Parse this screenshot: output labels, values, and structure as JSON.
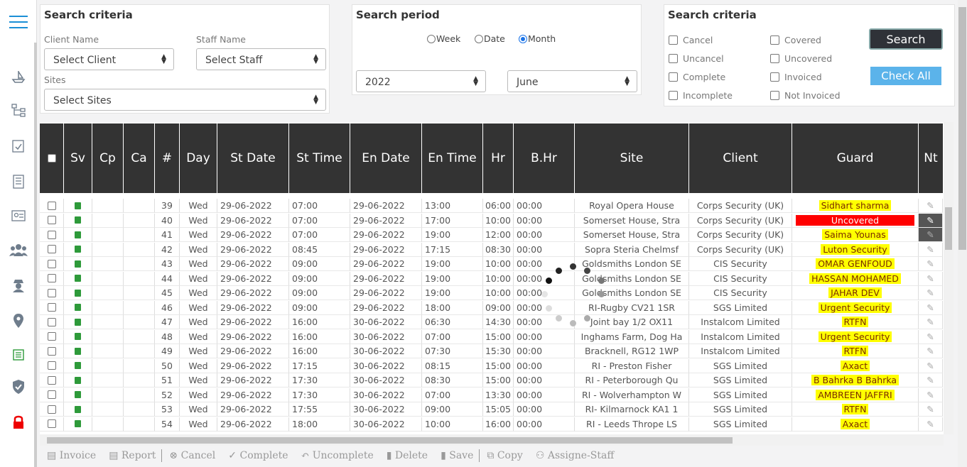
{
  "left_panel": {
    "title": "Search criteria",
    "client_label": "Client Name",
    "client_value": "Select Client",
    "staff_label": "Staff Name",
    "staff_value": "Select Staff",
    "sites_label": "Sites",
    "sites_value": "Select Sites"
  },
  "period_panel": {
    "title": "Search period",
    "week": "Week",
    "date": "Date",
    "month": "Month",
    "selected": "Month",
    "year": "2022",
    "month_value": "June"
  },
  "right_panel": {
    "title": "Search criteria",
    "checks": [
      "Cancel",
      "Uncancel",
      "Complete",
      "Incomplete",
      "Covered",
      "Uncovered",
      "Invoiced",
      "Not Invoiced"
    ],
    "search_btn": "Search",
    "check_all_btn": "Check All"
  },
  "table": {
    "headers": [
      "",
      "Sv",
      "Cp",
      "Ca",
      "#",
      "Day",
      "St Date",
      "St Time",
      "En Date",
      "En Time",
      "Hr",
      "B.Hr",
      "Site",
      "Client",
      "Guard",
      "Nt"
    ],
    "rows": [
      {
        "n": "39",
        "day": "Wed",
        "sd": "29-06-2022",
        "st": "07:00",
        "ed": "29-06-2022",
        "et": "13:00",
        "hr": "06:00",
        "bhr": "00:00",
        "site": "Royal Opera House",
        "client": "Corps Security (UK)",
        "guard": "Sidhart sharma",
        "gtype": "hl"
      },
      {
        "n": "40",
        "day": "Wed",
        "sd": "29-06-2022",
        "st": "07:00",
        "ed": "29-06-2022",
        "et": "17:00",
        "hr": "10:00",
        "bhr": "00:00",
        "site": "Somerset House, Stra",
        "client": "Corps Security (UK)",
        "guard": "Uncovered",
        "gtype": "red"
      },
      {
        "n": "41",
        "day": "Wed",
        "sd": "29-06-2022",
        "st": "07:00",
        "ed": "29-06-2022",
        "et": "19:00",
        "hr": "12:00",
        "bhr": "00:00",
        "site": "Somerset House, Stra",
        "client": "Corps Security (UK)",
        "guard": "Saima Younas",
        "gtype": "hl"
      },
      {
        "n": "42",
        "day": "Wed",
        "sd": "29-06-2022",
        "st": "08:45",
        "ed": "29-06-2022",
        "et": "17:15",
        "hr": "08:30",
        "bhr": "00:00",
        "site": "Sopra Steria Chelmsf",
        "client": "Corps Security (UK)",
        "guard": "Luton Security",
        "gtype": "hl"
      },
      {
        "n": "43",
        "day": "Wed",
        "sd": "29-06-2022",
        "st": "09:00",
        "ed": "29-06-2022",
        "et": "19:00",
        "hr": "10:00",
        "bhr": "00:00",
        "site": "Goldsmiths London SE",
        "client": "CIS Security",
        "guard": "OMAR GENFOUD",
        "gtype": "hl"
      },
      {
        "n": "44",
        "day": "Wed",
        "sd": "29-06-2022",
        "st": "09:00",
        "ed": "29-06-2022",
        "et": "19:00",
        "hr": "10:00",
        "bhr": "00:00",
        "site": "Goldsmiths London SE",
        "client": "CIS Security",
        "guard": "HASSAN MOHAMED",
        "gtype": "hl"
      },
      {
        "n": "45",
        "day": "Wed",
        "sd": "29-06-2022",
        "st": "09:00",
        "ed": "29-06-2022",
        "et": "19:00",
        "hr": "10:00",
        "bhr": "00:00",
        "site": "Goldsmiths London SE",
        "client": "CIS Security",
        "guard": "JAHAR DEV",
        "gtype": "hl"
      },
      {
        "n": "46",
        "day": "Wed",
        "sd": "29-06-2022",
        "st": "09:00",
        "ed": "29-06-2022",
        "et": "18:00",
        "hr": "09:00",
        "bhr": "00:00",
        "site": "RI-Rugby CV21 1SR",
        "client": "SGS Limited",
        "guard": "Urgent Security",
        "gtype": "hl"
      },
      {
        "n": "47",
        "day": "Wed",
        "sd": "29-06-2022",
        "st": "16:00",
        "ed": "30-06-2022",
        "et": "06:30",
        "hr": "14:30",
        "bhr": "00:00",
        "site": "Joint bay 1/2 OX11",
        "client": "Instalcom Limited",
        "guard": "RTFN",
        "gtype": "hl"
      },
      {
        "n": "48",
        "day": "Wed",
        "sd": "29-06-2022",
        "st": "16:00",
        "ed": "30-06-2022",
        "et": "07:00",
        "hr": "15:00",
        "bhr": "00:00",
        "site": "Inghams Farm, Dog Ha",
        "client": "Instalcom Limited",
        "guard": "Urgent Security",
        "gtype": "hl"
      },
      {
        "n": "49",
        "day": "Wed",
        "sd": "29-06-2022",
        "st": "16:00",
        "ed": "30-06-2022",
        "et": "07:30",
        "hr": "15:30",
        "bhr": "00:00",
        "site": "Bracknell, RG12 1WP",
        "client": "Instalcom Limited",
        "guard": "RTFN",
        "gtype": "hl"
      },
      {
        "n": "50",
        "day": "Wed",
        "sd": "29-06-2022",
        "st": "17:15",
        "ed": "30-06-2022",
        "et": "08:15",
        "hr": "15:00",
        "bhr": "00:00",
        "site": "RI - Preston Fisher",
        "client": "SGS Limited",
        "guard": "Axact",
        "gtype": "hl"
      },
      {
        "n": "51",
        "day": "Wed",
        "sd": "29-06-2022",
        "st": "17:30",
        "ed": "30-06-2022",
        "et": "08:30",
        "hr": "15:00",
        "bhr": "00:00",
        "site": "RI - Peterborough Qu",
        "client": "SGS Limited",
        "guard": "B Bahrka B Bahrka",
        "gtype": "hl"
      },
      {
        "n": "52",
        "day": "Wed",
        "sd": "29-06-2022",
        "st": "17:30",
        "ed": "30-06-2022",
        "et": "07:00",
        "hr": "13:30",
        "bhr": "00:00",
        "site": "RI - Wolverhampton W",
        "client": "SGS Limited",
        "guard": "AMBREEN JAFFRI",
        "gtype": "hl"
      },
      {
        "n": "53",
        "day": "Wed",
        "sd": "29-06-2022",
        "st": "17:55",
        "ed": "30-06-2022",
        "et": "09:00",
        "hr": "15:05",
        "bhr": "00:00",
        "site": "RI- Kilmarnock KA1 1",
        "client": "SGS Limited",
        "guard": "RTFN",
        "gtype": "hl"
      },
      {
        "n": "54",
        "day": "Wed",
        "sd": "29-06-2022",
        "st": "18:00",
        "ed": "30-06-2022",
        "et": "10:00",
        "hr": "16:00",
        "bhr": "00:00",
        "site": "RI - Leeds Thrope LS",
        "client": "SGS Limited",
        "guard": "Axact",
        "gtype": "hl"
      }
    ]
  },
  "toolbar": {
    "invoice": "Invoice",
    "report": "Report",
    "cancel": "Cancel",
    "complete": "Complete",
    "uncomplete": "Uncomplete",
    "delete": "Delete",
    "save": "Save",
    "copy": "Copy",
    "assign": "Assigne-Staff"
  },
  "colors": {
    "header_bg": "#333333",
    "accent": "#1b8fd6",
    "highlight": "#ffff00",
    "uncovered": "#ff0000",
    "save_icon": "#2e9a3a"
  }
}
